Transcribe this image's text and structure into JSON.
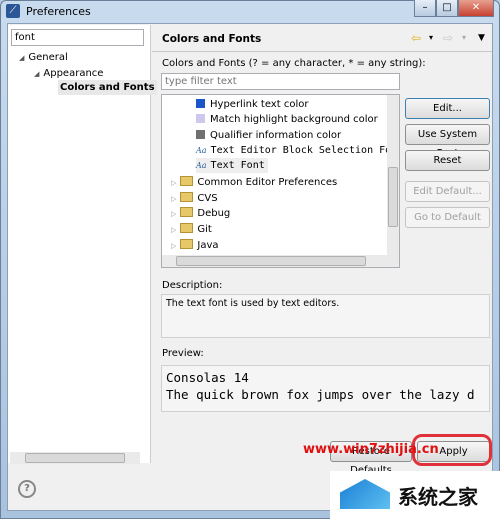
{
  "window": {
    "title": "Preferences",
    "controls": [
      "–",
      "□",
      "✕"
    ]
  },
  "sidebar": {
    "filter_value": "font",
    "tree": [
      {
        "label": "General",
        "level": 0
      },
      {
        "label": "Appearance",
        "level": 1
      },
      {
        "label": "Colors and Fonts",
        "level": 2,
        "selected": true
      }
    ]
  },
  "page": {
    "title": "Colors and Fonts",
    "filter_label": "Colors and Fonts (? = any character, * = any string):",
    "filter_placeholder": "type filter text"
  },
  "list": [
    {
      "label": "Hyperlink text color",
      "type": "color",
      "color": "#1a56c8"
    },
    {
      "label": "Match highlight background color",
      "type": "color",
      "color": "#cfc8ee"
    },
    {
      "label": "Qualifier information color",
      "type": "color",
      "color": "#707070"
    },
    {
      "label": "Text Editor Block Selection Font",
      "type": "font"
    },
    {
      "label": "Text Font",
      "type": "font",
      "selected": true
    },
    {
      "label": "Common Editor Preferences",
      "type": "category"
    },
    {
      "label": "CVS",
      "type": "category"
    },
    {
      "label": "Debug",
      "type": "category"
    },
    {
      "label": "Git",
      "type": "category"
    },
    {
      "label": "Java",
      "type": "category"
    }
  ],
  "buttons": {
    "edit": "Edit...",
    "use_system_font": "Use System Font",
    "reset": "Reset",
    "edit_default": "Edit Default...",
    "go_to_default": "Go to Default",
    "restore_defaults": "Restore Defaults",
    "apply": "Apply"
  },
  "description": {
    "label": "Description:",
    "text": "The text font is used by text editors."
  },
  "preview": {
    "label": "Preview:",
    "line1": "Consolas 14",
    "line2": "The quick brown fox jumps over the lazy d"
  },
  "watermark": {
    "url": "www.win7zhijia.cn",
    "brand": "系统之家"
  }
}
